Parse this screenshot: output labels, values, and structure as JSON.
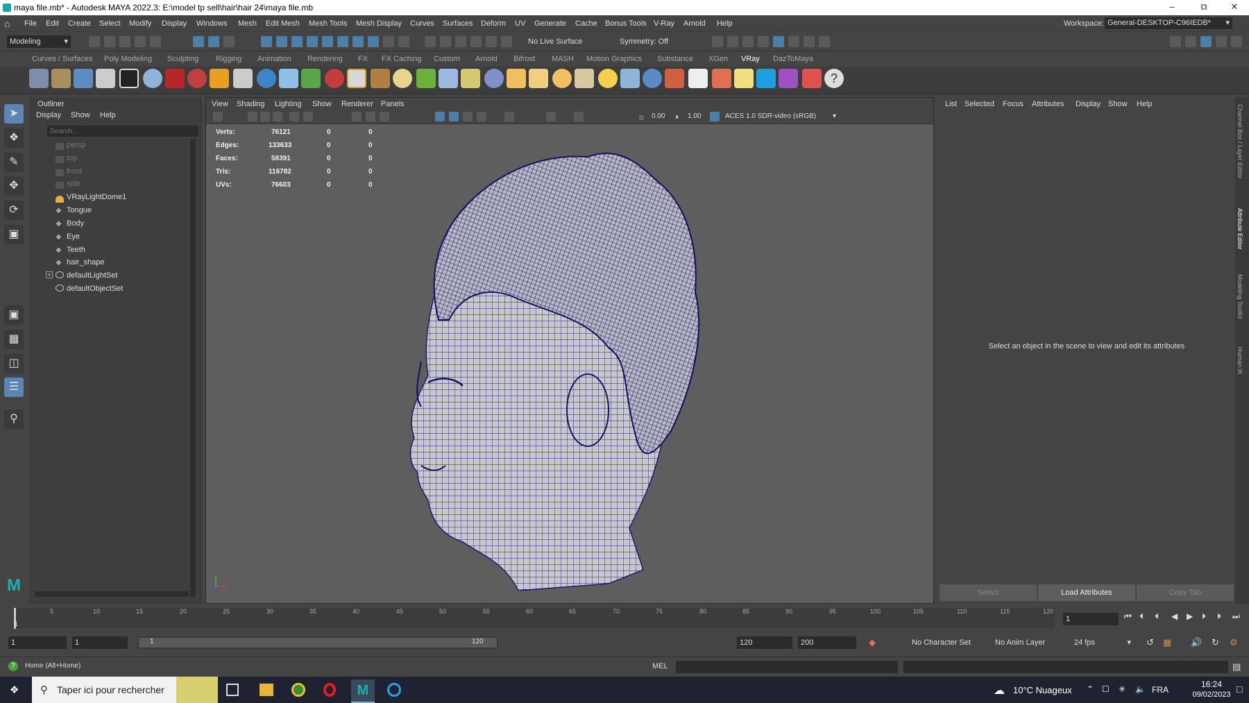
{
  "window": {
    "title": "maya file.mb* - Autodesk MAYA 2022.3: E:\\model tp sell\\hair\\hair 24\\maya file.mb"
  },
  "menus": [
    "File",
    "Edit",
    "Create",
    "Select",
    "Modify",
    "Display",
    "Windows",
    "Mesh",
    "Edit Mesh",
    "Mesh Tools",
    "Mesh Display",
    "Curves",
    "Surfaces",
    "Deform",
    "UV",
    "Generate",
    "Cache",
    "Bonus Tools",
    "V-Ray",
    "Arnold",
    "Help"
  ],
  "workspace": {
    "label": "Workspace:",
    "value": "General-DESKTOP-C96IEDB*"
  },
  "status": {
    "menuset": "Modeling",
    "live_surface": "No Live Surface",
    "symmetry": "Symmetry: Off"
  },
  "shelf_tabs": [
    "Curves / Surfaces",
    "Poly Modeling",
    "Sculpting",
    "Rigging",
    "Animation",
    "Rendering",
    "FX",
    "FX Caching",
    "Custom",
    "Arnold",
    "Bifrost",
    "MASH",
    "Motion Graphics",
    "Substance",
    "XGen",
    "VRay",
    "DazToMaya"
  ],
  "shelf_active": "VRay",
  "outliner": {
    "title": "Outliner",
    "menu": [
      "Display",
      "Show",
      "Help"
    ],
    "search_placeholder": "Search...",
    "items": [
      "persp",
      "top",
      "front",
      "side",
      "VRayLightDome1",
      "Tongue",
      "Body",
      "Eye",
      "Teeth",
      "hair_shape",
      "defaultLightSet",
      "defaultObjectSet"
    ]
  },
  "viewport": {
    "menu": [
      "View",
      "Shading",
      "Lighting",
      "Show",
      "Renderer",
      "Panels"
    ],
    "exposure": "0.00",
    "gamma": "1.00",
    "colorspace": "ACES 1.0 SDR-video (sRGB)",
    "hud": [
      {
        "label": "Verts:",
        "v1": "76121",
        "v2": "0",
        "v3": "0"
      },
      {
        "label": "Edges:",
        "v1": "133633",
        "v2": "0",
        "v3": "0"
      },
      {
        "label": "Faces:",
        "v1": "58391",
        "v2": "0",
        "v3": "0"
      },
      {
        "label": "Tris:",
        "v1": "116782",
        "v2": "0",
        "v3": "0"
      },
      {
        "label": "UVs:",
        "v1": "76603",
        "v2": "0",
        "v3": "0"
      }
    ]
  },
  "attribute_editor": {
    "menu": [
      "List",
      "Selected",
      "Focus",
      "Attributes",
      "Display",
      "Show",
      "Help"
    ],
    "message": "Select an object in the scene to view and edit its attributes",
    "buttons": [
      "Select",
      "Load Attributes",
      "Copy Tab"
    ]
  },
  "side_tabs": [
    "Channel Box / Layer Editor",
    "Attribute Editor",
    "Modeling Toolkit",
    "Human IK"
  ],
  "timeline": {
    "ticks": [
      "1",
      "5",
      "10",
      "15",
      "20",
      "25",
      "30",
      "35",
      "40",
      "45",
      "50",
      "55",
      "60",
      "65",
      "70",
      "75",
      "80",
      "85",
      "90",
      "95",
      "100",
      "105",
      "110",
      "115",
      "120"
    ],
    "current_frame": "1"
  },
  "range": {
    "start": "1",
    "inner_start": "1",
    "slider_start": "1",
    "slider_end": "120",
    "end": "120",
    "outer_end": "200",
    "character_set": "No Character Set",
    "anim_layer": "No Anim Layer",
    "fps": "24 fps"
  },
  "cmdline": {
    "help": "Home (Alt+Home)",
    "lang": "MEL"
  },
  "taskbar": {
    "search": "Taper ici pour rechercher",
    "weather": "10°C  Nuageux",
    "lang": "FRA",
    "time": "16:24",
    "date": "09/02/2023"
  }
}
